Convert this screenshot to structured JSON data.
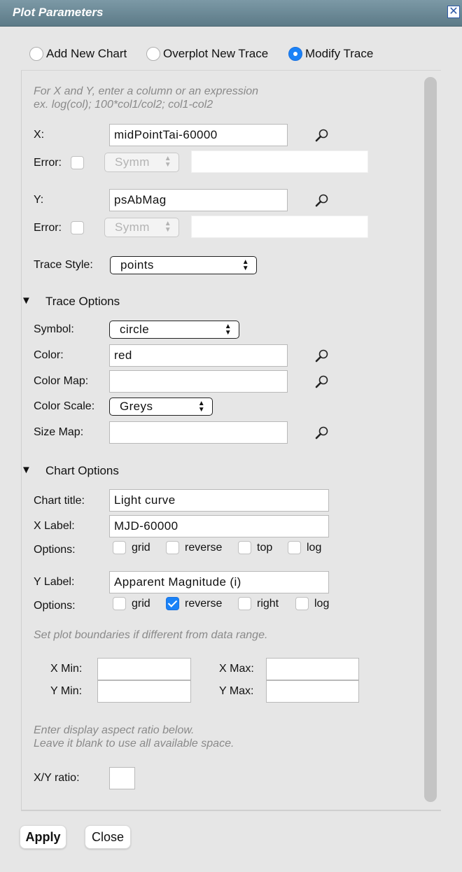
{
  "window": {
    "title": "Plot Parameters",
    "close_glyph": "✕"
  },
  "modes": [
    {
      "label": "Add New Chart",
      "selected": false
    },
    {
      "label": "Overplot New Trace",
      "selected": false
    },
    {
      "label": "Modify Trace",
      "selected": true
    }
  ],
  "hint_xy": {
    "line1": "For X and Y, enter a column or an expression",
    "line2": "ex. log(col); 100*col1/col2; col1-col2"
  },
  "x": {
    "label": "X:",
    "value": "midPointTai-60000",
    "error_label": "Error:",
    "error_checked": false,
    "error_mode": "Symm",
    "error_value": ""
  },
  "y": {
    "label": "Y:",
    "value": "psAbMag",
    "error_label": "Error:",
    "error_checked": false,
    "error_mode": "Symm",
    "error_value": ""
  },
  "trace_style": {
    "label": "Trace Style:",
    "value": "points"
  },
  "trace_options": {
    "title": "Trace Options",
    "symbol": {
      "label": "Symbol:",
      "value": "circle"
    },
    "color": {
      "label": "Color:",
      "value": "red"
    },
    "color_map": {
      "label": "Color Map:",
      "value": ""
    },
    "color_scale": {
      "label": "Color Scale:",
      "value": "Greys"
    },
    "size_map": {
      "label": "Size Map:",
      "value": ""
    }
  },
  "chart_options": {
    "title": "Chart Options",
    "chart_title": {
      "label": "Chart title:",
      "value": "Light curve"
    },
    "x_label": {
      "label": "X Label:",
      "value": "MJD-60000"
    },
    "x_options": {
      "label": "Options:",
      "items": [
        {
          "label": "grid",
          "checked": false
        },
        {
          "label": "reverse",
          "checked": false
        },
        {
          "label": "top",
          "checked": false
        },
        {
          "label": "log",
          "checked": false
        }
      ]
    },
    "y_label": {
      "label": "Y Label:",
      "value": "Apparent Magnitude (i)"
    },
    "y_options": {
      "label": "Options:",
      "items": [
        {
          "label": "grid",
          "checked": false
        },
        {
          "label": "reverse",
          "checked": true
        },
        {
          "label": "right",
          "checked": false
        },
        {
          "label": "log",
          "checked": false
        }
      ]
    },
    "bounds_hint": "Set plot boundaries if different from data range.",
    "x_min": {
      "label": "X Min:",
      "value": ""
    },
    "x_max": {
      "label": "X Max:",
      "value": ""
    },
    "y_min": {
      "label": "Y Min:",
      "value": ""
    },
    "y_max": {
      "label": "Y Max:",
      "value": ""
    },
    "aspect_hint1": "Enter display aspect ratio below.",
    "aspect_hint2": "Leave it blank to use all available space.",
    "xy_ratio": {
      "label": "X/Y ratio:",
      "value": ""
    }
  },
  "footer": {
    "apply": "Apply",
    "close": "Close"
  },
  "icons": {
    "search": "magnifier-icon",
    "expand": "triangle-down-icon"
  },
  "colors": {
    "titlebar": "#6b8896",
    "accent": "#1a82f7",
    "background": "#e6e6e6"
  }
}
